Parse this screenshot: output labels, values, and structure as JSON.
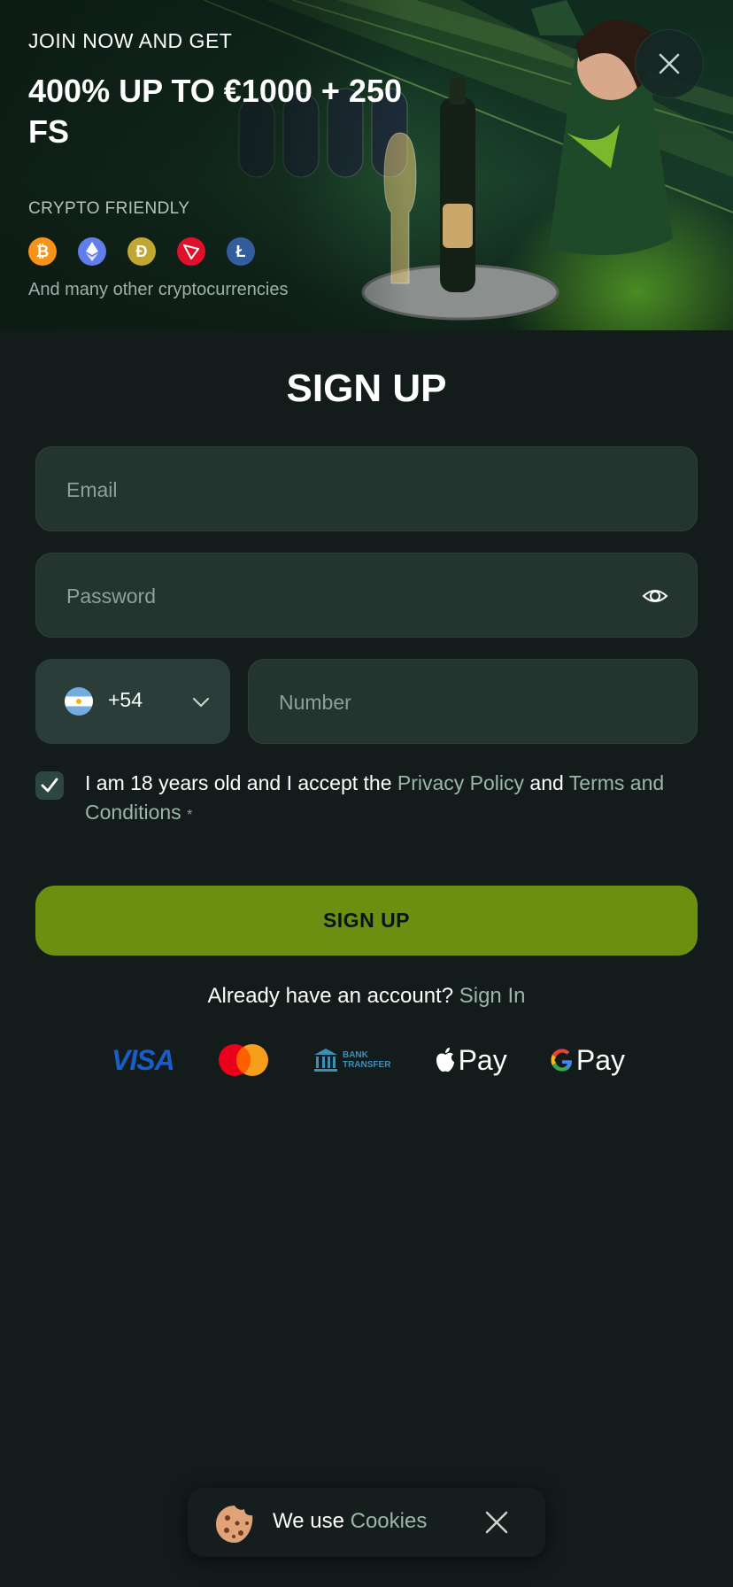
{
  "banner": {
    "kicker": "JOIN NOW AND GET",
    "headline": "400% UP TO €1000 + 250 FS",
    "crypto_label": "CRYPTO FRIENDLY",
    "crypto_icons": [
      "bitcoin-icon",
      "ethereum-icon",
      "dogecoin-icon",
      "tron-icon",
      "litecoin-icon"
    ],
    "crypto_more": "And many other cryptocurrencies",
    "close_icon": "close-icon"
  },
  "form": {
    "title": "SIGN UP",
    "email_placeholder": "Email",
    "password_placeholder": "Password",
    "password_toggle_icon": "eye-icon",
    "country_flag": "argentina-flag-icon",
    "country_code": "+54",
    "number_placeholder": "Number",
    "terms": {
      "checked": true,
      "prefix": "I am 18 years old and I accept the ",
      "privacy_link": "Privacy Policy",
      "and": " and ",
      "terms_link": "Terms and Conditions",
      "required": "*"
    },
    "submit_label": "SIGN UP",
    "signin_prompt": "Already have an account? ",
    "signin_link": "Sign In"
  },
  "payments": {
    "visa": "VISA",
    "mastercard": "mastercard-logo",
    "bank_line1": "BANK",
    "bank_line2": "TRANSFER",
    "apple_pay": "Pay",
    "google_pay": "Pay"
  },
  "cookie_banner": {
    "text": "We use ",
    "link": "Cookies",
    "icon": "cookie-icon",
    "close_icon": "close-icon"
  },
  "colors": {
    "background": "#131b1b",
    "input": "#24352f",
    "accent_button": "#6c8f12",
    "link": "#9bb7ac"
  }
}
